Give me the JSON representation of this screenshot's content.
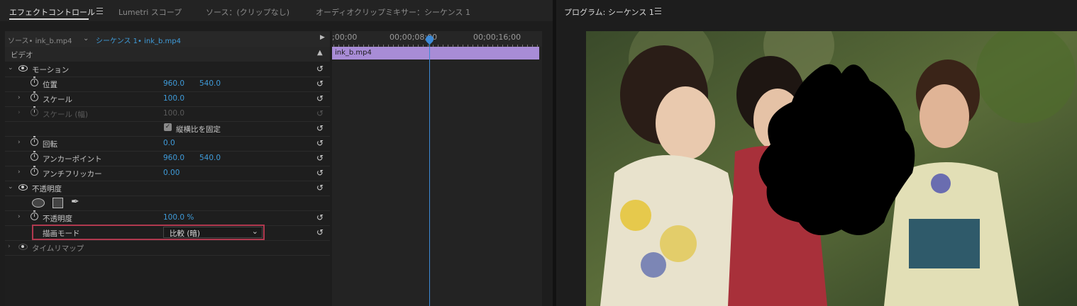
{
  "top_tabs": {
    "effect_controls": "エフェクトコントロール",
    "lumetri": "Lumetri スコープ",
    "source": "ソース：(クリップなし)",
    "audio_mixer": "オーディオクリップミキサー：シーケンス 1"
  },
  "ec_header": {
    "source_clip": "ソース• ink_b.mp4",
    "sequence_clip": "シーケンス 1• ink_b.mp4",
    "expand_arrow": "▶"
  },
  "video_header": "ビデオ",
  "rows": {
    "motion": "モーション",
    "position_label": "位置",
    "position_x": "960.0",
    "position_y": "540.0",
    "scale_label": "スケール",
    "scale_value": "100.0",
    "scale_width_label": "スケール (幅)",
    "scale_width_value": "100.0",
    "uniform_scale": "縦横比を固定",
    "rotation_label": "回転",
    "rotation_value": "0.0",
    "anchor_label": "アンカーポイント",
    "anchor_x": "960.0",
    "anchor_y": "540.0",
    "flicker_label": "アンチフリッカー",
    "flicker_value": "0.00",
    "opacity_section": "不透明度",
    "opacity_label": "不透明度",
    "opacity_value": "100.0 %",
    "blend_label": "描画モード",
    "blend_value": "比較 (暗)",
    "time_remap": "タイムリマップ"
  },
  "timeline": {
    "tick_labels": [
      ";00;00",
      "00;00;08;00",
      "00;00;16;00"
    ],
    "clip_name": "ink_b.mp4"
  },
  "program_monitor": {
    "title": "プログラム: シーケンス 1"
  },
  "colors": {
    "accent_blue": "#3f9bd9",
    "clip_purple": "#a88cd6",
    "highlight_red": "#b0394f"
  }
}
